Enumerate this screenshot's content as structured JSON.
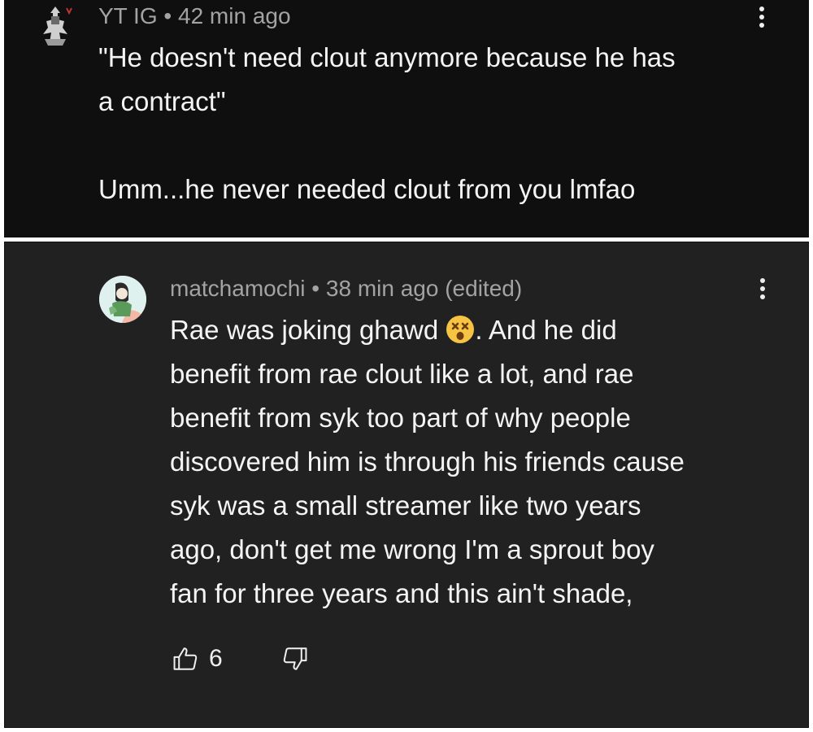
{
  "comments": [
    {
      "username": "YT IG",
      "separator": "•",
      "time": "42 min ago",
      "edited": "",
      "lines": [
        "\"He doesn't need clout anymore because he has",
        "a contract\"",
        "",
        "Umm...he never needed clout from you lmfao"
      ]
    },
    {
      "username": "matchamochi",
      "separator": "•",
      "time": "38 min ago",
      "edited": "(edited)",
      "line1_before_emoji": "Rae was joking ghawd ",
      "line1_after_emoji": ". And he did",
      "lines": [
        "benefit from rae clout like a lot, and rae",
        "benefit from syk too part of why people",
        "discovered him is through his friends cause",
        "syk was a small streamer like two years",
        "ago, don't get me wrong I'm a sprout boy",
        "fan for three years and this ain't shade,"
      ],
      "like_count": "6"
    }
  ],
  "icons": {
    "more": "more-vert-icon",
    "like": "thumb-up-icon",
    "dislike": "thumb-down-icon",
    "emoji": "dizzy-face-emoji"
  },
  "colors": {
    "top_bg": "#0f0f0f",
    "bottom_bg": "#212121",
    "meta_text": "#a3a3a3",
    "body_text": "#f4f4f4"
  }
}
